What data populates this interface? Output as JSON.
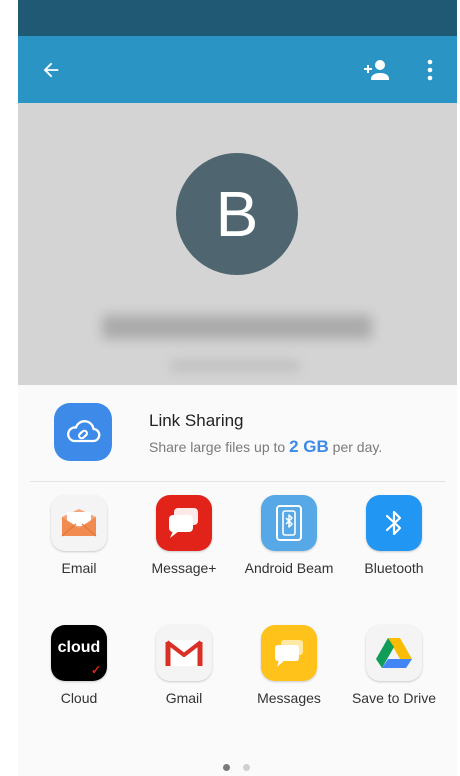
{
  "profile": {
    "avatar_letter": "B"
  },
  "link_sharing": {
    "title": "Link Sharing",
    "subtitle_pre": "Share large files up to",
    "subtitle_amount": "2 GB",
    "subtitle_post": "per day."
  },
  "apps": [
    {
      "label": "Email",
      "icon": "email-icon"
    },
    {
      "label": "Message+",
      "icon": "message-plus-icon"
    },
    {
      "label": "Android Beam",
      "icon": "android-beam-icon"
    },
    {
      "label": "Bluetooth",
      "icon": "bluetooth-icon"
    },
    {
      "label": "Cloud",
      "icon": "cloud-app-icon",
      "icon_text": "cloud"
    },
    {
      "label": "Gmail",
      "icon": "gmail-icon"
    },
    {
      "label": "Messages",
      "icon": "messages-icon"
    },
    {
      "label": "Save to Drive",
      "icon": "drive-icon"
    }
  ],
  "pagination": {
    "pages": 2,
    "active": 0
  },
  "colors": {
    "status_bar": "#1f5974",
    "app_bar": "#2a94c4",
    "avatar": "#4f6670",
    "link_accent": "#3d8ae8"
  }
}
